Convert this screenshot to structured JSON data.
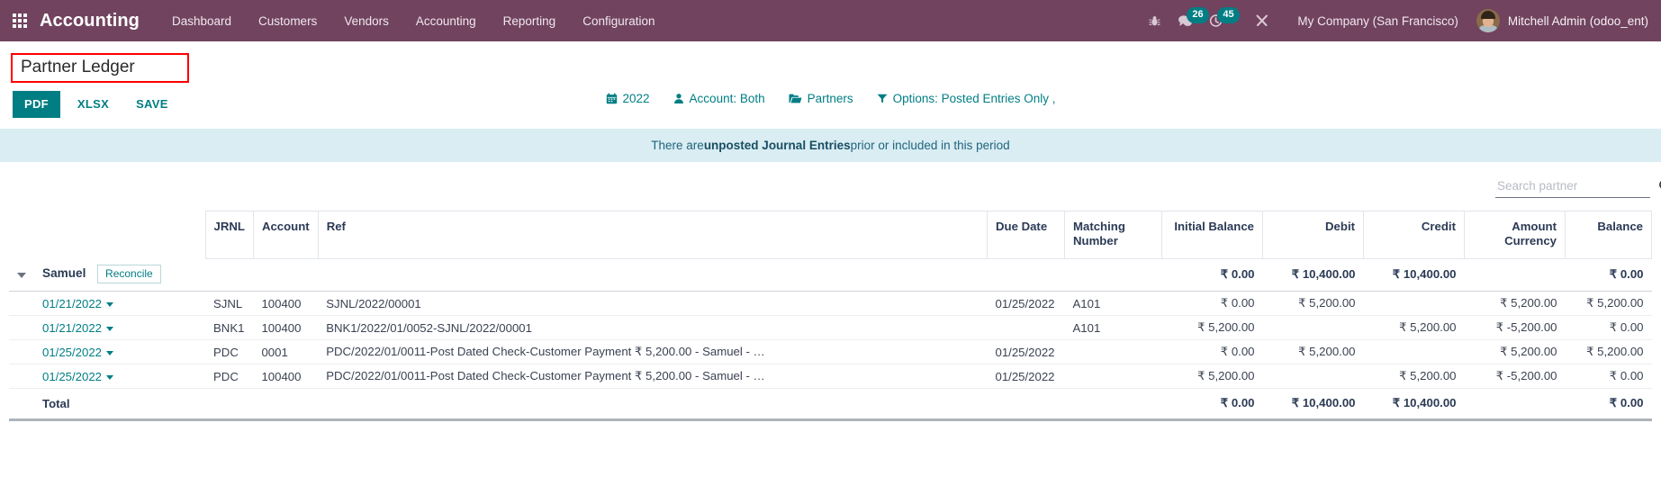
{
  "navbar": {
    "apps_icon": "apps-grid-icon",
    "brand": "Accounting",
    "menu": [
      {
        "label": "Dashboard"
      },
      {
        "label": "Customers"
      },
      {
        "label": "Vendors"
      },
      {
        "label": "Accounting"
      },
      {
        "label": "Reporting"
      },
      {
        "label": "Configuration"
      }
    ],
    "sys_icons": [
      {
        "name": "bug-icon",
        "badge": ""
      },
      {
        "name": "chat-icon",
        "badge": "26"
      },
      {
        "name": "activity-clock-icon",
        "badge": "45"
      },
      {
        "name": "tools-icon",
        "badge": ""
      }
    ],
    "company": "My Company (San Francisco)",
    "username": "Mitchell Admin (odoo_ent)",
    "bg_color": "#71435f",
    "badge_color": "#017e84"
  },
  "page": {
    "title": "Partner Ledger",
    "title_highlight_color": "#ff0000"
  },
  "toolbar": {
    "pdf_label": "PDF",
    "xlsx_label": "XLSX",
    "save_label": "SAVE",
    "accent_color": "#017e84"
  },
  "filters": [
    {
      "icon": "calendar-icon",
      "label": "2022"
    },
    {
      "icon": "person-icon",
      "label": "Account: Both"
    },
    {
      "icon": "folder-icon",
      "label": "Partners"
    },
    {
      "icon": "funnel-icon",
      "label": "Options: Posted Entries Only ,"
    }
  ],
  "alert": {
    "prefix": "There are ",
    "bold": "unposted Journal Entries",
    "suffix": " prior or included in this period",
    "bg_color": "#d9edf3"
  },
  "search": {
    "placeholder": "Search partner",
    "value": "",
    "icon": "search-icon"
  },
  "table": {
    "headers": {
      "jrnl": "JRNL",
      "account": "Account",
      "ref": "Ref",
      "due_date": "Due Date",
      "matching_number": "Matching Number",
      "initial_balance": "Initial Balance",
      "debit": "Debit",
      "credit": "Credit",
      "amount_currency": "Amount Currency",
      "balance": "Balance"
    },
    "partner": {
      "name": "Samuel",
      "reconcile_label": "Reconcile",
      "initial_balance": "₹ 0.00",
      "debit": "₹ 10,400.00",
      "credit": "₹ 10,400.00",
      "amount_currency": "",
      "balance": "₹ 0.00"
    },
    "rows": [
      {
        "date": "01/21/2022",
        "jrnl": "SJNL",
        "account": "100400",
        "ref": "SJNL/2022/00001",
        "due_date": "01/25/2022",
        "matching_number": "A101",
        "initial_balance": "₹ 0.00",
        "debit": "₹ 5,200.00",
        "credit": "",
        "amount_currency": "₹ 5,200.00",
        "balance": "₹ 5,200.00"
      },
      {
        "date": "01/21/2022",
        "jrnl": "BNK1",
        "account": "100400",
        "ref": "BNK1/2022/01/0052-SJNL/2022/00001",
        "due_date": "",
        "matching_number": "A101",
        "initial_balance": "₹ 5,200.00",
        "debit": "",
        "credit": "₹ 5,200.00",
        "amount_currency": "₹ -5,200.00",
        "balance": "₹ 0.00"
      },
      {
        "date": "01/25/2022",
        "jrnl": "PDC",
        "account": "0001",
        "ref": "PDC/2022/01/0011-Post Dated Check-Customer Payment ₹ 5,200.00 - Samuel - …",
        "due_date": "01/25/2022",
        "matching_number": "",
        "initial_balance": "₹ 0.00",
        "debit": "₹ 5,200.00",
        "credit": "",
        "amount_currency": "₹ 5,200.00",
        "balance": "₹ 5,200.00"
      },
      {
        "date": "01/25/2022",
        "jrnl": "PDC",
        "account": "100400",
        "ref": "PDC/2022/01/0011-Post Dated Check-Customer Payment ₹ 5,200.00 - Samuel - …",
        "due_date": "01/25/2022",
        "matching_number": "",
        "initial_balance": "₹ 5,200.00",
        "debit": "",
        "credit": "₹ 5,200.00",
        "amount_currency": "₹ -5,200.00",
        "balance": "₹ 0.00"
      }
    ],
    "total": {
      "label": "Total",
      "initial_balance": "₹ 0.00",
      "debit": "₹ 10,400.00",
      "credit": "₹ 10,400.00",
      "amount_currency": "",
      "balance": "₹ 0.00"
    }
  }
}
